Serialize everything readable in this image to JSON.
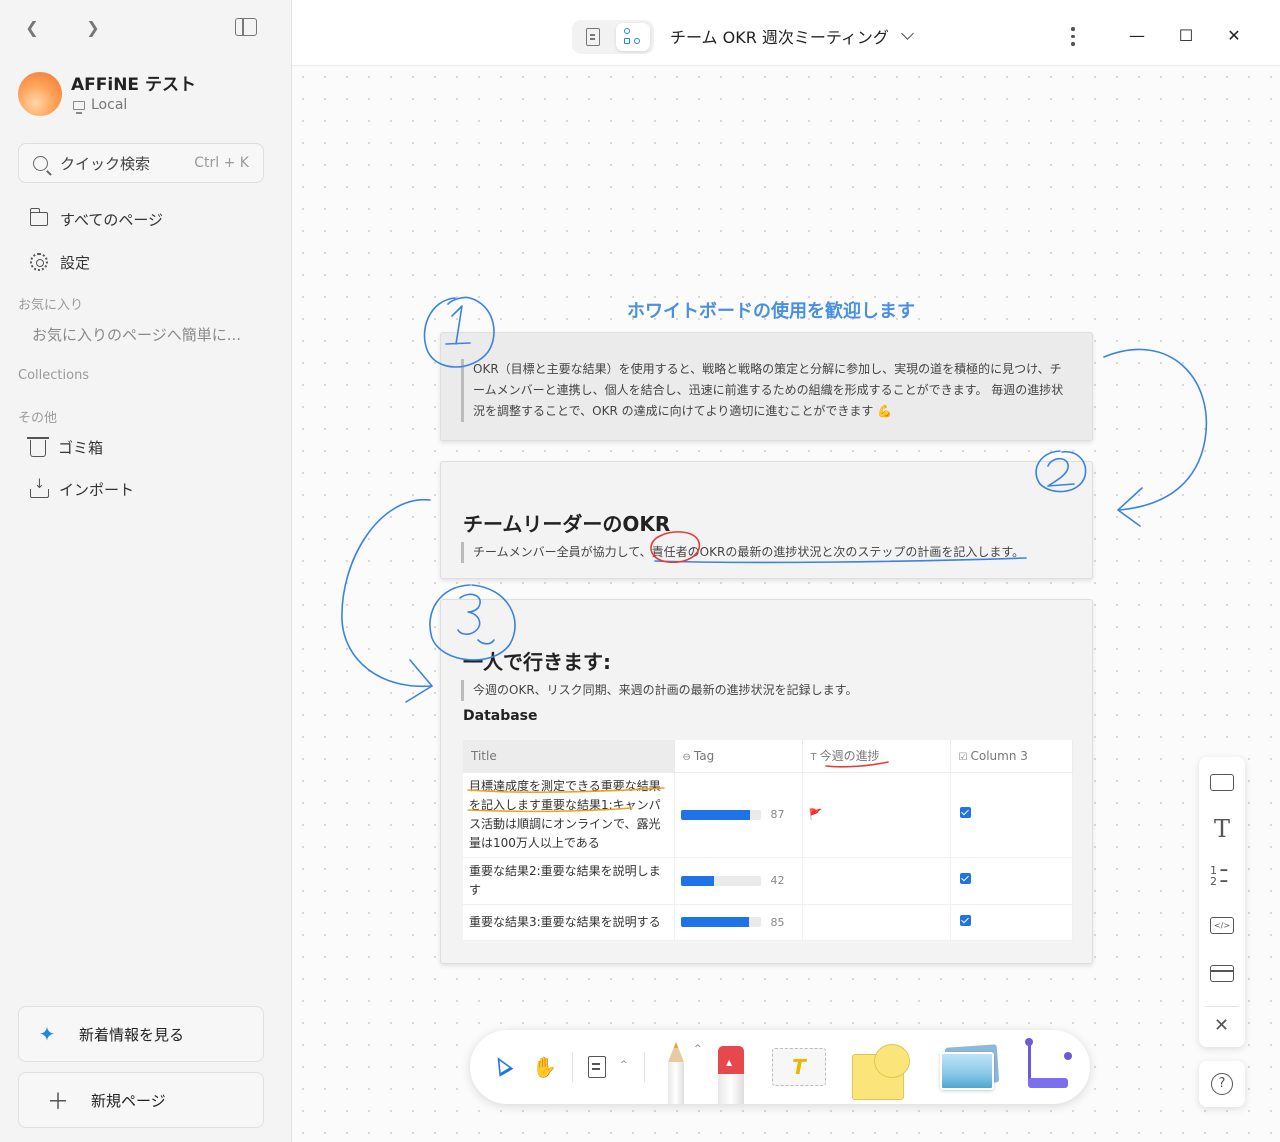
{
  "sidebar": {
    "workspace_name": "AFFiNE テスト",
    "workspace_type": "Local",
    "search_label": "クイック検索",
    "search_shortcut": "Ctrl + K",
    "all_pages": "すべてのページ",
    "settings": "設定",
    "favorites_label": "お気に入り",
    "favorites_empty": "お気に入りのページへ簡単に...",
    "collections_label": "Collections",
    "others_label": "その他",
    "trash": "ゴミ箱",
    "import": "インポート",
    "whats_new": "新着情報を見る",
    "new_page": "新規ページ"
  },
  "header": {
    "doc_title": "チーム OKR 週次ミーティング"
  },
  "canvas": {
    "welcome_title": "ホワイトボードの使用を歓迎します",
    "note1": {
      "text": "OKR（目標と主要な結果）を使用すると、戦略と戦略の策定と分解に参加し、実現の道を積極的に見つけ、チームメンバーと連携し、個人を結合し、迅速に前進するための組織を形成することができます。 毎週の進捗状況を調整することで、OKR の達成に向けてより適切に進むことができます 💪"
    },
    "note2": {
      "heading": "チームリーダーのOKR",
      "text": "チームメンバー全員が協力して、責任者のOKRの最新の進捗状況と次のステップの計画を記入します。"
    },
    "note3": {
      "heading": "一人で行きます:",
      "text": "今週のOKR、リスク同期、来週の計画の最新の進捗状況を記録します。",
      "db_label": "Database",
      "columns": [
        "Title",
        "Tag",
        "今週の進捗",
        "Column 3"
      ],
      "rows": [
        {
          "title": "目標達成度を測定できる重要な結果を記入します重要な結果1:キャンパス活動は順調にオンラインで、露光量は100万人以上である",
          "progress": 87,
          "note": "🚩",
          "checked": true
        },
        {
          "title": "重要な結果2:重要な結果を説明します",
          "progress": 42,
          "note": "",
          "checked": true
        },
        {
          "title": "重要な結果3:重要な結果を説明する",
          "progress": 85,
          "note": "",
          "checked": true
        }
      ]
    },
    "annotations": [
      "1",
      "2",
      "3"
    ]
  },
  "colors": {
    "accent": "#1e74e6",
    "title_blue": "#4a90e2",
    "pen_blue": "#3b82e6",
    "pen_red": "#e53935",
    "pen_orange": "#f0a020"
  }
}
